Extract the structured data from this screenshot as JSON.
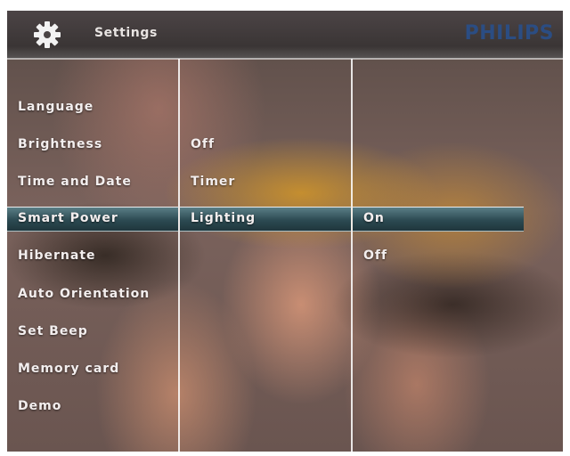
{
  "header": {
    "title": "Settings",
    "brand": "PHILIPS",
    "icon": "gear-icon"
  },
  "menu": {
    "col1": [
      "Language",
      "Brightness",
      "Time and Date",
      "Smart Power",
      "Hibernate",
      "Auto Orientation",
      "Set Beep",
      "Memory card",
      "Demo"
    ],
    "col2": [
      "Off",
      "Timer",
      "Lighting"
    ],
    "col3": [
      "On",
      "Off"
    ],
    "selected": {
      "col1": "Smart Power",
      "col2": "Lighting",
      "col3": "On"
    }
  },
  "colors": {
    "brand": "#2b4d83",
    "highlight": "#2c4a52",
    "text": "#f3eeee"
  }
}
